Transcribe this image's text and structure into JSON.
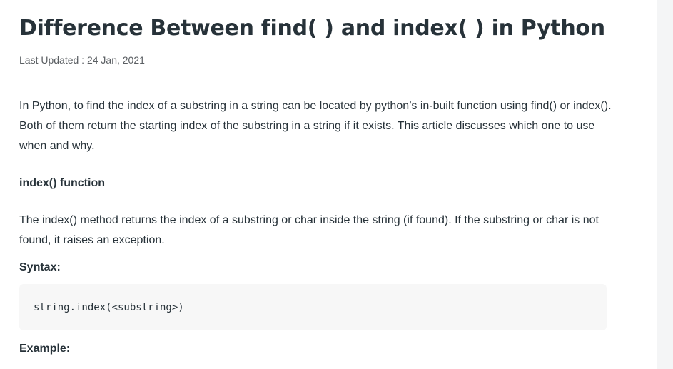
{
  "article": {
    "title": "Difference Between find( ) and index( ) in Python",
    "last_updated": "Last Updated : 24 Jan, 2021",
    "intro": "In Python, to find the index of a substring in a string can be located by python’s in-built function using find() or index(). Both of them return the starting index of the substring in a string if it exists. This article discusses which one to use when and why.",
    "section_heading": "index() function",
    "section_text": "The index() method returns the index of a substring or char inside the string (if found). If the substring or char is not found, it raises an exception.",
    "syntax_label": "Syntax:",
    "syntax_code": "string.index(<substring>)",
    "example_label": "Example:"
  }
}
